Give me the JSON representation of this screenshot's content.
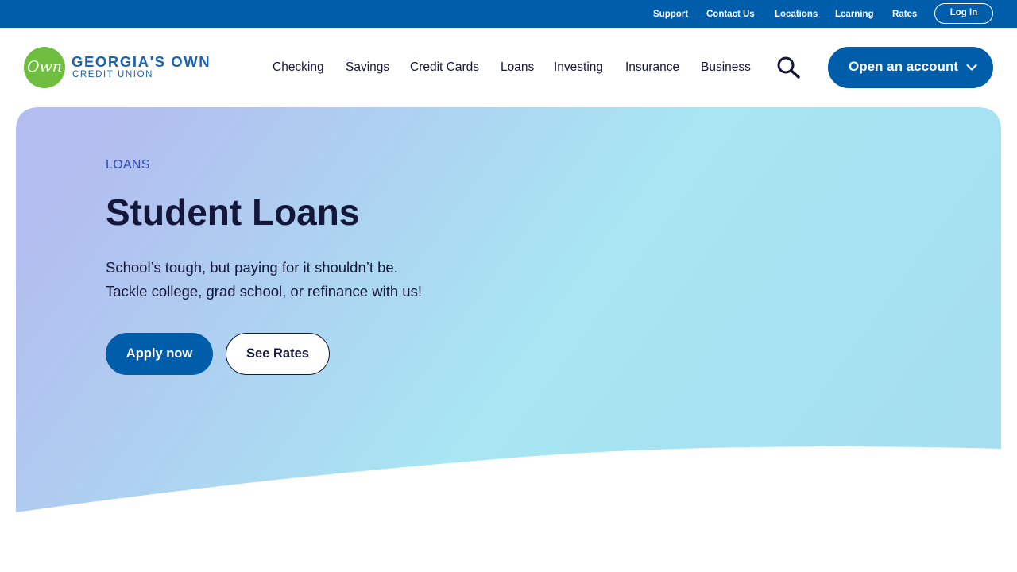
{
  "utility_nav": {
    "support": "Support",
    "contact": "Contact Us",
    "locations": "Locations",
    "learning": "Learning",
    "rates": "Rates",
    "login": "Log In"
  },
  "brand": {
    "logo_mark": "Own",
    "name": "GEORGIA'S OWN",
    "subtitle": "CREDIT UNION",
    "primary_color": "#005daa",
    "logo_green": "#6fbe3f"
  },
  "main_nav": {
    "items": [
      "Checking",
      "Savings",
      "Credit Cards",
      "Loans",
      "Investing",
      "Insurance",
      "Business"
    ],
    "search_icon": "search-icon",
    "cta_label": "Open an account",
    "cta_icon": "chevron-down-icon"
  },
  "hero": {
    "eyebrow": "LOANS",
    "title": "Student Loans",
    "description_line1": "School’s tough, but paying for it shouldn’t be.",
    "description_line2": "Tackle college, grad school, or refinance with us!",
    "primary_button": "Apply now",
    "secondary_button": "See Rates",
    "gradient_start": "#b3bdef",
    "gradient_end": "#a5e5f3"
  }
}
